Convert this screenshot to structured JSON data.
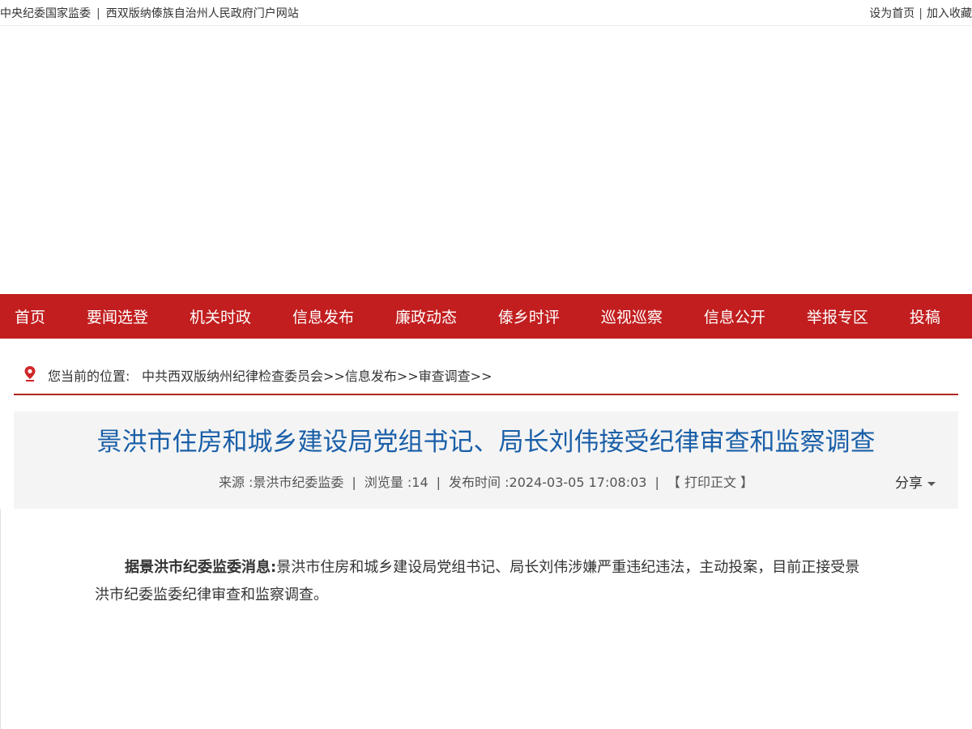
{
  "topbar": {
    "link_ccdi": "中央纪委国家监委",
    "separator": "|",
    "link_gov": "西双版纳傣族自治州人民政府门户网站",
    "set_home": "设为首页",
    "right_separator": "|",
    "add_favorite": "加入收藏"
  },
  "nav": {
    "items": [
      {
        "label": "首页"
      },
      {
        "label": "要闻选登"
      },
      {
        "label": "机关时政"
      },
      {
        "label": "信息发布"
      },
      {
        "label": "廉政动态"
      },
      {
        "label": "傣乡时评"
      },
      {
        "label": "巡视巡察"
      },
      {
        "label": "信息公开"
      },
      {
        "label": "举报专区"
      },
      {
        "label": "投稿"
      }
    ]
  },
  "breadcrumb": {
    "label": "您当前的位置:",
    "items": [
      "中共西双版纳州纪律检查委员会",
      ">>",
      "信息发布",
      ">>",
      "审查调查",
      ">>"
    ]
  },
  "article": {
    "title": "景洪市住房和城乡建设局党组书记、局长刘伟接受纪律审查和监察调查",
    "source": "来源 :景洪市纪委监委",
    "views": "浏览量 :14",
    "publish_time": "发布时间 :2024-03-05 17:08:03",
    "meta_separator": "|",
    "print_label": "【 打印正文 】",
    "share_label": "分享",
    "lead": "据景洪市纪委监委消息:",
    "body": "景洪市住房和城乡建设局党组书记、局长刘伟涉嫌严重违纪违法，主动投案，目前正接受景洪市纪委监委纪律审查和监察调查。"
  },
  "colors": {
    "nav_background": "#c21e1f",
    "title_color": "#1a5fa8",
    "breadcrumb_underline": "#b22222",
    "pin_icon": "#d0262b"
  },
  "icons": {
    "breadcrumb_pin": "map-pin-icon",
    "share_caret": "caret-down-icon"
  }
}
